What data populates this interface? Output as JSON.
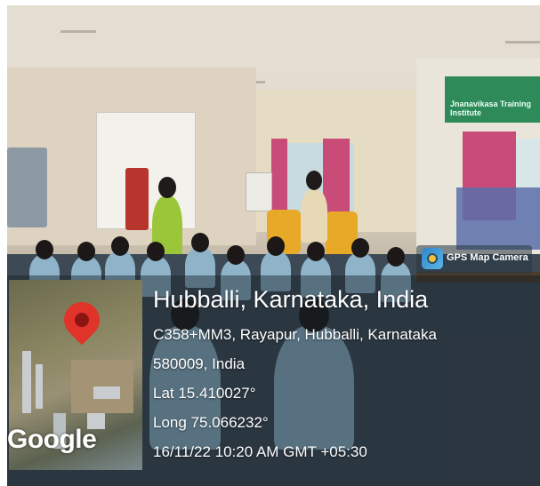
{
  "overlay": {
    "app_label": "GPS Map Camera",
    "app_icon": "camera-lens-icon",
    "map_pin_icon": "map-pin-icon",
    "map_brand": "Google",
    "location_title": "Hubballi, Karnataka, India",
    "address_line1": "C358+MM3, Rayapur, Hubballi, Karnataka",
    "address_line2": "580009, India",
    "latitude": "Lat 15.410027°",
    "longitude": "Long 75.066232°",
    "timestamp": "16/11/22 10:20 AM GMT +05:30"
  },
  "scene": {
    "sign_text": "Jnanavikasa Training Institute",
    "colors": {
      "pin": "#e0332a",
      "sign": "#2f8a5a",
      "tanks": "#e8a928",
      "uniform": "#8fb4c9"
    }
  }
}
